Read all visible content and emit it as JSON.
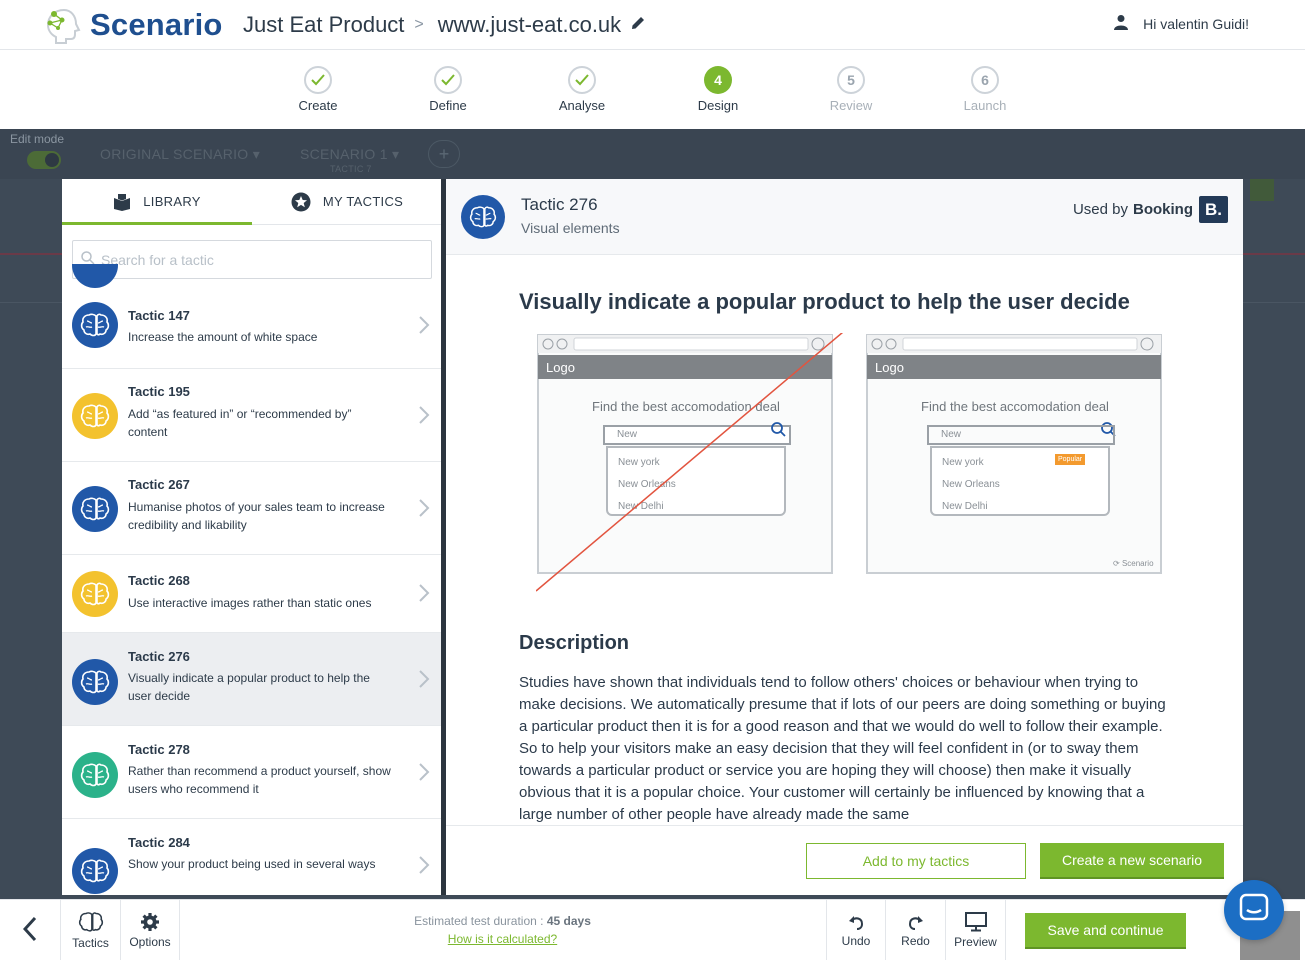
{
  "header": {
    "brand": "Scenario",
    "project": "Just Eat Product",
    "separator": ">",
    "site": "www.just-eat.co.uk",
    "greeting": "Hi valentin Guidi!"
  },
  "stepper": {
    "steps": [
      {
        "num": "",
        "label": "Create",
        "state": "done"
      },
      {
        "num": "",
        "label": "Define",
        "state": "done"
      },
      {
        "num": "",
        "label": "Analyse",
        "state": "done"
      },
      {
        "num": "4",
        "label": "Design",
        "state": "active"
      },
      {
        "num": "5",
        "label": "Review",
        "state": "todo"
      },
      {
        "num": "6",
        "label": "Launch",
        "state": "todo"
      }
    ]
  },
  "background": {
    "edit_mode": "Edit mode",
    "tab_original": "ORIGINAL SCENARIO",
    "tab_scenario": "SCENARIO 1",
    "tab_scenario_sub": "TACTIC 7",
    "add": "+"
  },
  "library": {
    "tab_library": "LIBRARY",
    "tab_my_tactics": "MY TACTICS",
    "search_placeholder": "Search for a tactic",
    "items": [
      {
        "title": "Tactic 147",
        "desc": "Increase the amount of white space",
        "color": "#2158a8"
      },
      {
        "title": "Tactic 195",
        "desc": "Add “as featured in” or “recommended by” content",
        "color": "#f3c22e"
      },
      {
        "title": "Tactic 267",
        "desc": "Humanise photos of your sales team to increase credibility and likability",
        "color": "#2158a8"
      },
      {
        "title": "Tactic 268",
        "desc": "Use interactive images rather than static ones",
        "color": "#f3c22e"
      },
      {
        "title": "Tactic 276",
        "desc": "Visually indicate a popular product to help the user decide",
        "color": "#2158a8"
      },
      {
        "title": "Tactic 278",
        "desc": "Rather than recommend a product yourself, show users who recommend it",
        "color": "#2bb28a"
      },
      {
        "title": "Tactic 284",
        "desc": "Show your product being used in several ways",
        "color": "#2158a8"
      }
    ]
  },
  "detail": {
    "title": "Tactic 276",
    "category": "Visual elements",
    "used_by_prefix": "Used by",
    "used_by_brand": "Booking",
    "used_by_badge": "B.",
    "headline": "Visually indicate a popular product to help the user decide",
    "mockup": {
      "logo": "Logo",
      "heading": "Find the best accomodation deal",
      "input": "New",
      "options": [
        "New york",
        "New Orleans",
        "New Delhi"
      ],
      "badge": "Popular",
      "watermark": "Scenario"
    },
    "description_heading": "Description",
    "description": "Studies have shown that individuals tend to follow others' choices or behaviour when trying to make decisions. We automatically presume that if lots of our peers are doing something or buying a particular product then it is for a good reason and that we would do well to follow their example. So to help your visitors make an easy decision that they will feel confident in (or to sway them towards a particular product or service you are hoping they will choose) then make it visually obvious that it is a popular choice. Your customer will certainly be influenced by knowing that a large number of other people have already made the same",
    "btn_add": "Add to my tactics",
    "btn_create": "Create a new scenario"
  },
  "bottom": {
    "tactics": "Tactics",
    "options": "Options",
    "est_prefix": "Estimated test duration :",
    "est_value": "45 days",
    "how": "How is it calculated?",
    "undo": "Undo",
    "redo": "Redo",
    "preview": "Preview",
    "save": "Save and continue"
  },
  "colors": {
    "accent": "#7cb82f",
    "brand": "#1f4f8f",
    "blue": "#2158a8",
    "yellow": "#f3c22e",
    "teal": "#2bb28a"
  }
}
